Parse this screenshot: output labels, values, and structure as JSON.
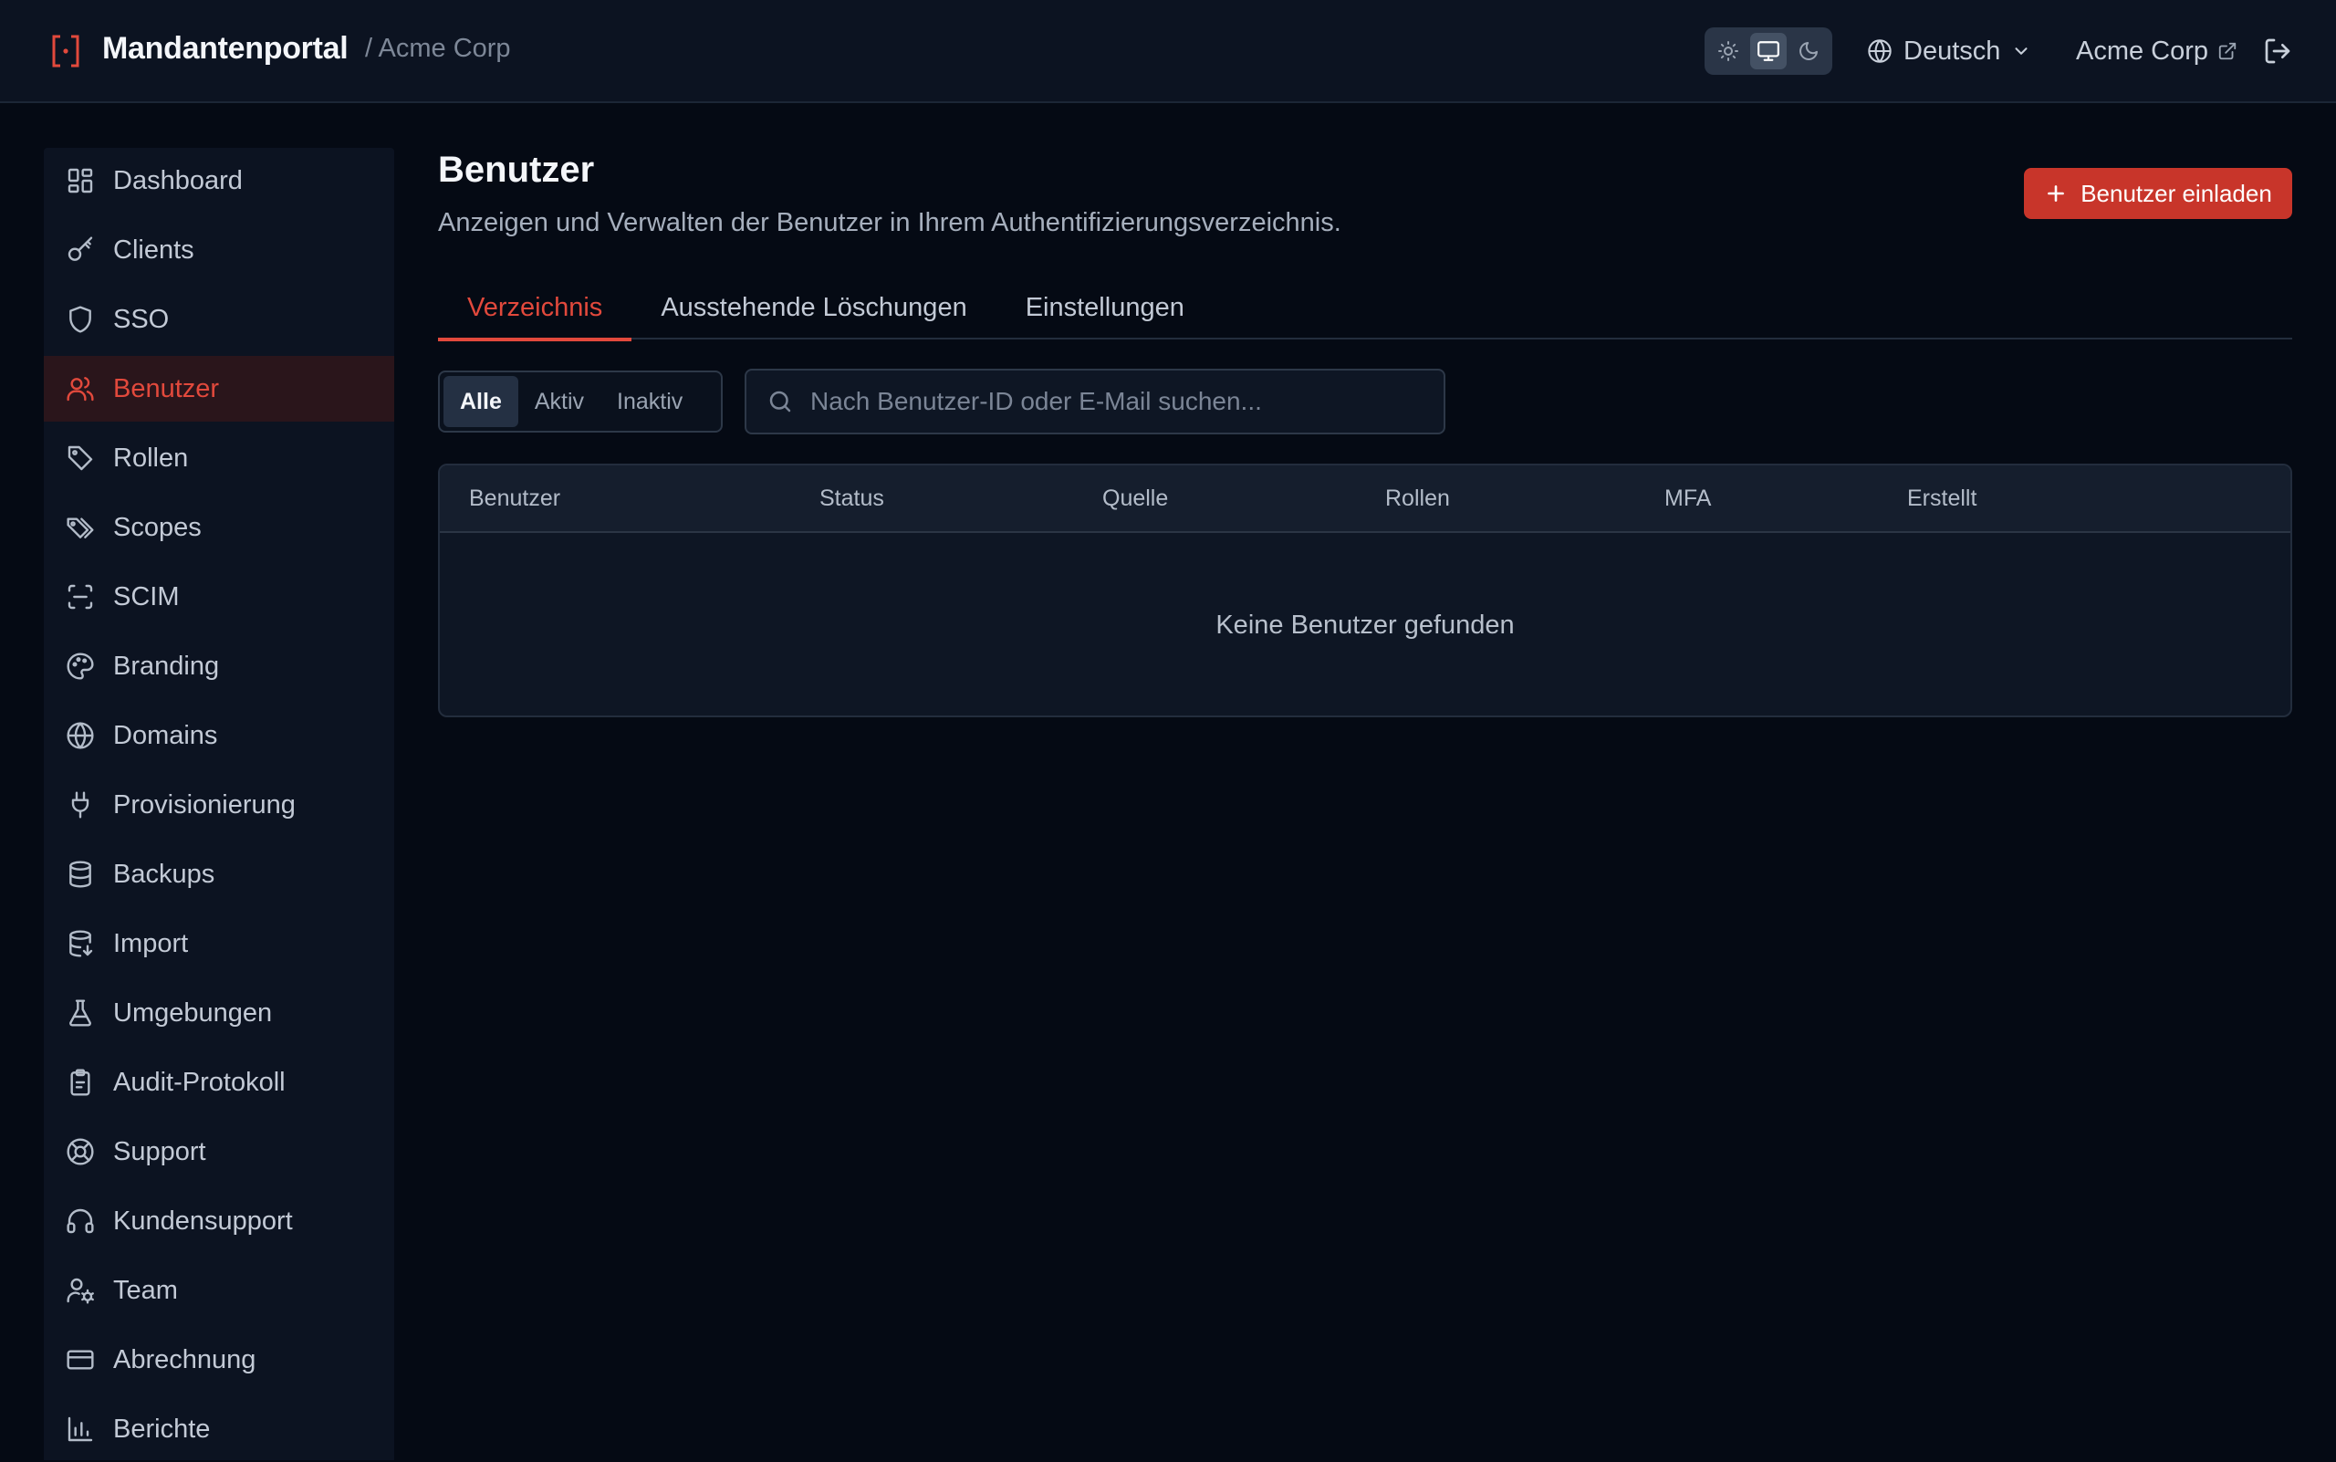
{
  "header": {
    "app_title": "Mandantenportal",
    "breadcrumb": "/ Acme Corp",
    "theme_options": [
      "light",
      "system",
      "dark"
    ],
    "theme_selected": "system",
    "language": "Deutsch",
    "tenant_name": "Acme Corp"
  },
  "sidebar": {
    "items": [
      {
        "label": "Dashboard",
        "icon": "dashboard-icon"
      },
      {
        "label": "Clients",
        "icon": "key-icon"
      },
      {
        "label": "SSO",
        "icon": "shield-icon"
      },
      {
        "label": "Benutzer",
        "icon": "users-icon",
        "active": true
      },
      {
        "label": "Rollen",
        "icon": "tag-icon"
      },
      {
        "label": "Scopes",
        "icon": "tags-icon"
      },
      {
        "label": "SCIM",
        "icon": "scan-icon"
      },
      {
        "label": "Branding",
        "icon": "palette-icon"
      },
      {
        "label": "Domains",
        "icon": "globe-icon"
      },
      {
        "label": "Provisionierung",
        "icon": "plug-icon"
      },
      {
        "label": "Backups",
        "icon": "database-icon"
      },
      {
        "label": "Import",
        "icon": "database-import-icon"
      },
      {
        "label": "Umgebungen",
        "icon": "flask-icon"
      },
      {
        "label": "Audit-Protokoll",
        "icon": "clipboard-icon"
      },
      {
        "label": "Support",
        "icon": "lifebuoy-icon"
      },
      {
        "label": "Kundensupport",
        "icon": "headset-icon"
      },
      {
        "label": "Team",
        "icon": "user-cog-icon"
      },
      {
        "label": "Abrechnung",
        "icon": "credit-card-icon"
      },
      {
        "label": "Berichte",
        "icon": "bar-chart-icon"
      }
    ]
  },
  "page": {
    "title": "Benutzer",
    "description": "Anzeigen und Verwalten der Benutzer in Ihrem Authentifizierungsverzeichnis.",
    "invite_button": "Benutzer einladen",
    "tabs": [
      {
        "label": "Verzeichnis",
        "active": true
      },
      {
        "label": "Ausstehende Löschungen"
      },
      {
        "label": "Einstellungen"
      }
    ],
    "filters": [
      {
        "label": "Alle",
        "active": true
      },
      {
        "label": "Aktiv"
      },
      {
        "label": "Inaktiv"
      }
    ],
    "search_placeholder": "Nach Benutzer-ID oder E-Mail suchen...",
    "search_value": ""
  },
  "table": {
    "columns": [
      "Benutzer",
      "Status",
      "Quelle",
      "Rollen",
      "MFA",
      "Erstellt"
    ],
    "rows": [],
    "empty_text": "Keine Benutzer gefunden"
  },
  "colors": {
    "accent": "#e2493c",
    "primary_button": "#c8352a",
    "background": "#050a14",
    "surface": "#0c1321"
  }
}
